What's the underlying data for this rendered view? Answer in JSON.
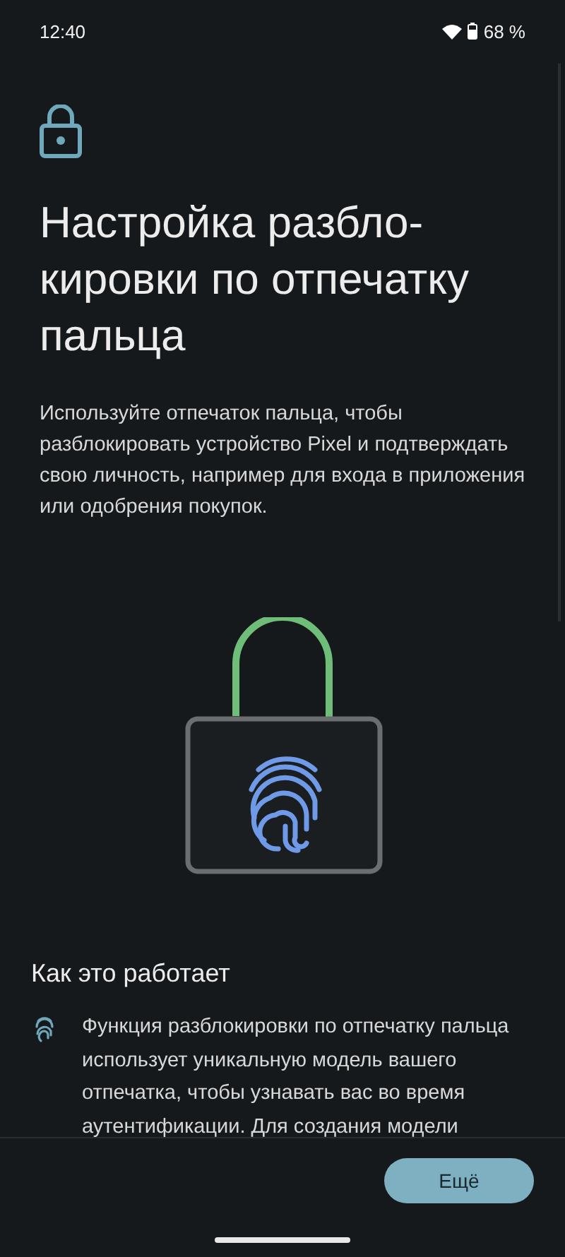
{
  "status_bar": {
    "time": "12:40",
    "battery": "68 %"
  },
  "title_lines": [
    "Настройка разбло-",
    "кировки по отпечатку",
    "пальца"
  ],
  "description": "Используйте отпечаток пальца, чтобы разблокировать устройство Pixel и подтверждать свою личность, например для входа в приложения или одобрения покупок.",
  "section": {
    "heading": "Как это работает",
    "items": [
      {
        "text": "Функция разблокировки по отпечатку пальца использует уникальную модель вашего отпечатка, чтобы узнавать вас во время аутентификации. Для создания модели"
      }
    ]
  },
  "buttons": [
    {
      "label": "Ещё"
    }
  ]
}
